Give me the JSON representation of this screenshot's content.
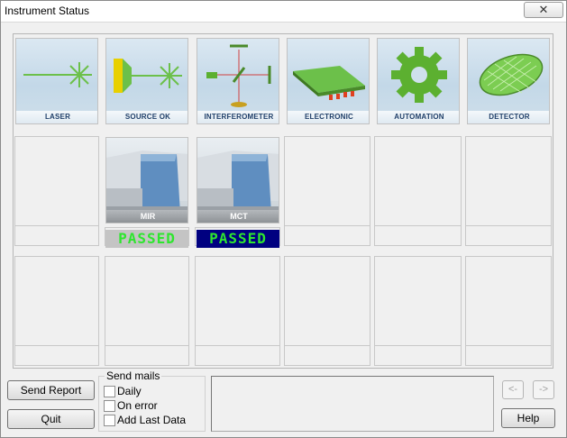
{
  "window": {
    "title": "Instrument Status",
    "close_glyph": "✕"
  },
  "tiles": [
    {
      "label": "LASER",
      "icon": "laser-icon"
    },
    {
      "label": "SOURCE OK",
      "icon": "source-icon"
    },
    {
      "label": "INTERFEROMETER",
      "icon": "interferometer-icon"
    },
    {
      "label": "ELECTRONIC",
      "icon": "electronic-board-icon"
    },
    {
      "label": "AUTOMATION",
      "icon": "gear-icon"
    },
    {
      "label": "DETECTOR",
      "icon": "detector-icon"
    }
  ],
  "detectors": [
    {
      "label": "MIR",
      "status": "PASSED",
      "status_bg": "#c4c4c4",
      "status_fg": "#2ee62e"
    },
    {
      "label": "MCT",
      "status": "PASSED",
      "status_bg": "#000080",
      "status_fg": "#2ee62e"
    }
  ],
  "colors": {
    "accent_green": "#8fd16a",
    "panel_bg": "#f0f0f0",
    "caption_text": "#21406a"
  },
  "buttons": {
    "send_report": "Send Report",
    "quit": "Quit",
    "prev": "<-",
    "next": "->",
    "help": "Help"
  },
  "send_mails": {
    "title": "Send mails",
    "options": [
      {
        "label": "Daily",
        "checked": false
      },
      {
        "label": "On error",
        "checked": false
      },
      {
        "label": "Add Last Data",
        "checked": false
      }
    ]
  },
  "message_text": ""
}
